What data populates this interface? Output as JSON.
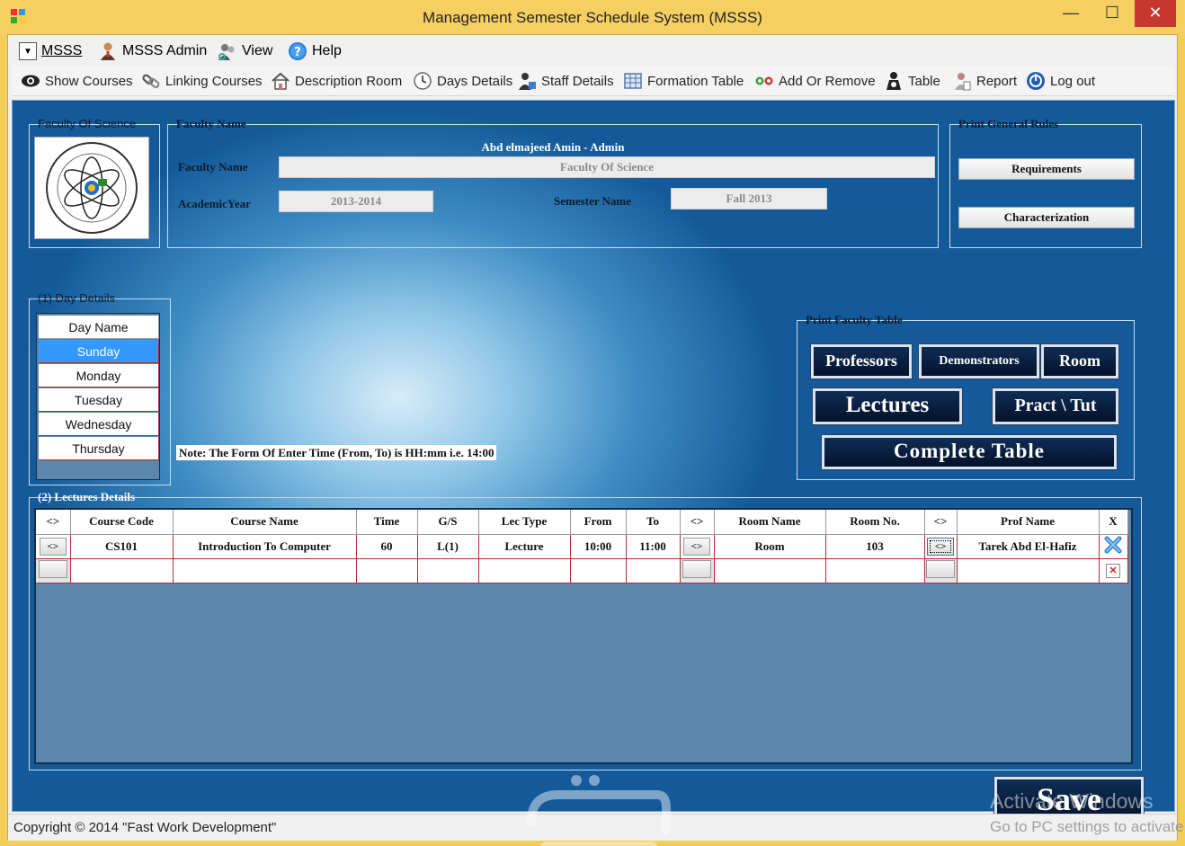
{
  "window": {
    "title": "Management Semester Schedule System (MSSS)",
    "minimize": "—",
    "maximize": "☐",
    "close": "✕"
  },
  "menu": [
    {
      "label": "MSSS",
      "icon": "dropdown-box-icon"
    },
    {
      "label": "MSSS Admin",
      "icon": "admin-person-icon"
    },
    {
      "label": "View",
      "icon": "view-people-icon"
    },
    {
      "label": "Help",
      "icon": "help-icon"
    }
  ],
  "toolbar": [
    {
      "label": "Show Courses",
      "icon": "eye-icon"
    },
    {
      "label": "Linking Courses",
      "icon": "link-icon"
    },
    {
      "label": "Description Room",
      "icon": "home-icon"
    },
    {
      "label": "Days Details",
      "icon": "clock-icon"
    },
    {
      "label": "Staff Details",
      "icon": "staff-icon"
    },
    {
      "label": "Formation Table",
      "icon": "table-icon"
    },
    {
      "label": "Add Or Remove",
      "icon": "add-remove-icon"
    },
    {
      "label": "Table",
      "icon": "person-table-icon"
    },
    {
      "label": "Report",
      "icon": "report-icon"
    },
    {
      "label": "Log out",
      "icon": "logout-icon"
    }
  ],
  "faculty_group": {
    "title": "Faculty Of Science"
  },
  "faculty_name_group": {
    "title": "Faculty Name",
    "user": "Abd elmajeed Amin - Admin",
    "faculty_label": "Faculty Name",
    "faculty_value": "Faculty Of Science",
    "year_label": "AcademicYear",
    "year_value": "2013-2014",
    "semester_label": "Semester Name",
    "semester_value": "Fall 2013"
  },
  "general_rules": {
    "title": "Print General Rules",
    "requirements": "Requirements",
    "characterization": "Characterization"
  },
  "day_details": {
    "title": "(1) Day Details",
    "header": "Day Name",
    "days": [
      "Sunday",
      "Monday",
      "Tuesday",
      "Wednesday",
      "Thursday"
    ],
    "selected": "Sunday"
  },
  "note": "Note: The Form Of Enter Time (From, To) is HH:mm i.e. 14:00",
  "faculty_table": {
    "title": "Print Faculty Table",
    "professors": "Professors",
    "demonstrators": "Demonstrators",
    "room": "Room",
    "lectures": "Lectures",
    "pract": "Pract \\ Tut",
    "complete": "Complete Table"
  },
  "lectures": {
    "title": "(2) Lectures Details",
    "columns": [
      "<>",
      "Course Code",
      "Course Name",
      "Time",
      "G/S",
      "Lec Type",
      "From",
      "To",
      "<>",
      "Room Name",
      "Room No.",
      "<>",
      "Prof Name",
      "X"
    ],
    "rows": [
      {
        "code": "CS101",
        "name": "Introduction To Computer",
        "time": "60",
        "gs": "L(1)",
        "type": "Lecture",
        "from": "10:00",
        "to": "11:00",
        "room_name": "Room",
        "room_no": "103",
        "prof": "Tarek Abd El-Hafiz"
      }
    ],
    "nav_glyph": "<>",
    "delete_glyph": "✕"
  },
  "save": "Save",
  "status": "Copyright © 2014 \"Fast Work Development\"",
  "activate": {
    "line1": "Activate Windows",
    "line2": "Go to PC settings to activate"
  }
}
